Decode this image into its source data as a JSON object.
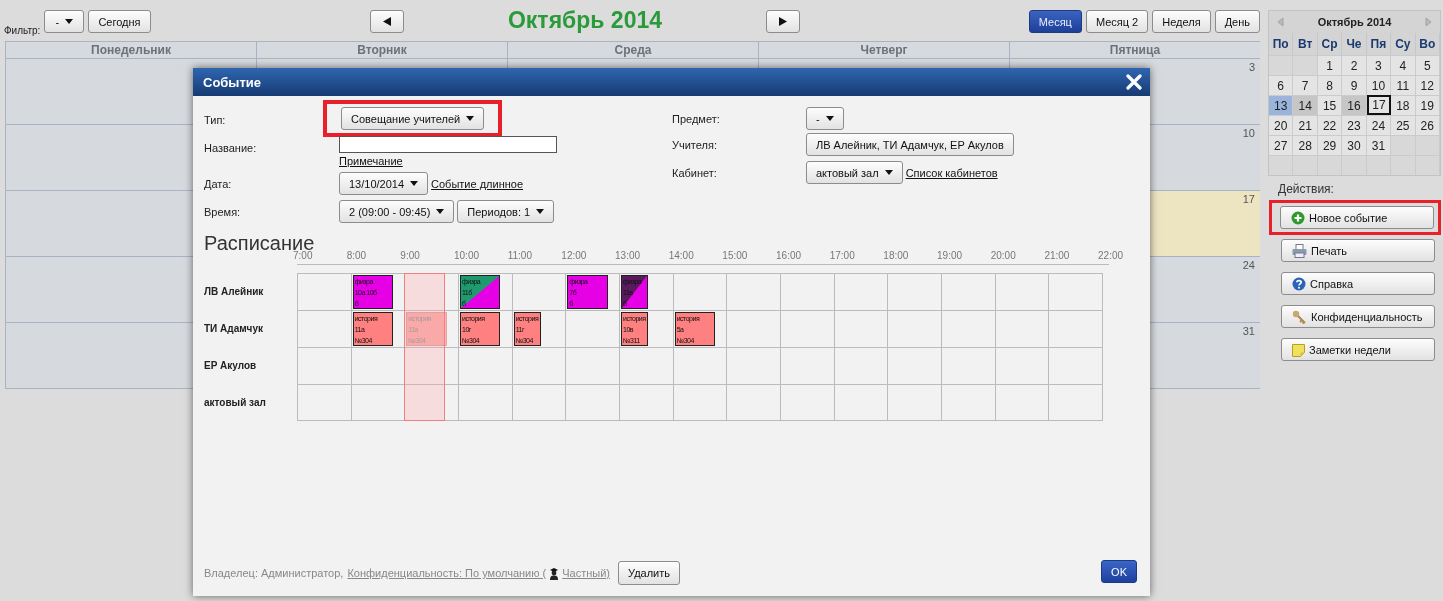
{
  "toolbar": {
    "filter_label": "Фильтр:",
    "filter_value": "-",
    "today_button": "Сегодня",
    "title": "Октябрь 2014",
    "views": [
      {
        "label": "Месяц",
        "selected": true
      },
      {
        "label": "Месяц 2",
        "selected": false
      },
      {
        "label": "Неделя",
        "selected": false
      },
      {
        "label": "День",
        "selected": false
      }
    ]
  },
  "calendar": {
    "weekdays": [
      "Понедельник",
      "Вторник",
      "Среда",
      "Четверг",
      "Пятница"
    ],
    "weeks": [
      {
        "monday": {
          "today": false
        },
        "friday": {
          "number": "3",
          "today": false
        }
      },
      {
        "monday": {
          "today": false
        },
        "friday": {
          "number": "10",
          "today": false
        }
      },
      {
        "monday": {
          "today": false
        },
        "friday": {
          "number": "17",
          "today": true
        }
      },
      {
        "monday": {
          "today": false
        },
        "friday": {
          "number": "24",
          "today": false
        }
      },
      {
        "monday": {
          "today": false
        },
        "friday": {
          "number": "31",
          "today": false
        }
      }
    ]
  },
  "dialog": {
    "title": "Событие",
    "fields_left": [
      {
        "label": "Тип:",
        "highlighted": true,
        "controls": [
          {
            "kind": "dropdown",
            "value": "Совещание учителей"
          }
        ]
      },
      {
        "label": "Название:",
        "highlighted": false,
        "controls": [
          {
            "kind": "input"
          },
          {
            "kind": "note_link",
            "text": "Примечание"
          }
        ]
      },
      {
        "label": "Дата:",
        "highlighted": false,
        "controls": [
          {
            "kind": "dropdown",
            "value": "13/10/2014"
          },
          {
            "kind": "link",
            "text": "Событие длинное"
          }
        ]
      },
      {
        "label": "Время:",
        "highlighted": false,
        "controls": [
          {
            "kind": "dropdown",
            "value": "2 (09:00 - 09:45)"
          },
          {
            "kind": "dropdown",
            "value": "Периодов: 1"
          }
        ]
      }
    ],
    "fields_right": [
      {
        "label": "Предмет:",
        "highlighted": false,
        "controls": [
          {
            "kind": "dropdown",
            "value": "-"
          }
        ]
      },
      {
        "label": "Учителя:",
        "highlighted": false,
        "controls": [
          {
            "kind": "button",
            "value": "ЛВ Алейник, ТИ Адамчук, ЕР Акулов"
          }
        ]
      },
      {
        "label": "Кабинет:",
        "highlighted": false,
        "controls": [
          {
            "kind": "dropdown",
            "value": "актовый зал"
          },
          {
            "kind": "link",
            "text": "Список кабинетов"
          }
        ]
      }
    ],
    "schedule": {
      "title": "Расписание",
      "hours": [
        {
          "label": "7:00",
          "selected": false
        },
        {
          "label": "8:00",
          "selected": false
        },
        {
          "label": "9:00",
          "selected": true
        },
        {
          "label": "10:00",
          "selected": false
        },
        {
          "label": "11:00",
          "selected": false
        },
        {
          "label": "12:00",
          "selected": false
        },
        {
          "label": "13:00",
          "selected": false
        },
        {
          "label": "14:00",
          "selected": false
        },
        {
          "label": "15:00",
          "selected": false
        },
        {
          "label": "16:00",
          "selected": false
        },
        {
          "label": "17:00",
          "selected": false
        },
        {
          "label": "18:00",
          "selected": false
        },
        {
          "label": "19:00",
          "selected": false
        },
        {
          "label": "20:00",
          "selected": false
        },
        {
          "label": "21:00",
          "selected": false
        },
        {
          "label": "22:00",
          "selected": false
        }
      ],
      "rows": [
        {
          "label": "ЛВ Алейник",
          "slots": [
            {
              "kind": "empty"
            },
            {
              "kind": "lesson",
              "ghost": false,
              "color": "#e600e6",
              "lines": [
                "физра",
                "10а 10б",
                "б"
              ]
            },
            {
              "kind": "empty"
            },
            {
              "kind": "lesson",
              "ghost": false,
              "color": "#e600e6",
              "corner": {
                "color": "#1e9a6e"
              },
              "lines": [
                "физра",
                "11б",
                "б"
              ]
            },
            {
              "kind": "empty"
            },
            {
              "kind": "lesson",
              "ghost": false,
              "color": "#e600e6",
              "lines": [
                "физра",
                "7б",
                "б"
              ]
            },
            {
              "kind": "short",
              "ghost": false,
              "color": "#e600e6",
              "corner": {
                "color": "#5a1a5e"
              },
              "lines": [
                "физра",
                "11в",
                "б"
              ]
            }
          ]
        },
        {
          "label": "ТИ Адамчук",
          "slots": [
            {
              "kind": "empty"
            },
            {
              "kind": "lesson",
              "ghost": false,
              "color": "#ff8080",
              "lines": [
                "история",
                "11а",
                "№304"
              ]
            },
            {
              "kind": "lesson",
              "ghost": true,
              "color": "#ff8080",
              "lines": [
                "история",
                "11а",
                "№304"
              ]
            },
            {
              "kind": "lesson",
              "ghost": false,
              "color": "#ff8080",
              "lines": [
                "история",
                "10г",
                "№304"
              ]
            },
            {
              "kind": "short",
              "ghost": false,
              "color": "#ff8080",
              "lines": [
                "история",
                "11г",
                "№304"
              ]
            },
            {
              "kind": "empty"
            },
            {
              "kind": "short",
              "ghost": false,
              "color": "#ff8080",
              "lines": [
                "история",
                "10в",
                "№311"
              ]
            },
            {
              "kind": "lesson",
              "ghost": false,
              "color": "#ff8080",
              "lines": [
                "история",
                "5а",
                "№304"
              ]
            }
          ]
        },
        {
          "label": "ЕР Акулов"
        },
        {
          "label": "актовый зал"
        }
      ]
    },
    "footer": {
      "owner": "Владелец: Администратор,",
      "privacy_link": "Конфиденциальность: По умолчанию (",
      "privacy_value": "Частный)",
      "delete_button": "Удалить",
      "ok_button": "OK"
    }
  },
  "sidebar": {
    "mini_calendar": {
      "title": "Октябрь 2014",
      "weekdays": [
        "По",
        "Вт",
        "Ср",
        "Че",
        "Пя",
        "Су",
        "Во"
      ],
      "weeks": [
        {
          "kind": "first",
          "days": [
            {
              "day": "1",
              "selected": false,
              "today": false,
              "marked": false
            },
            {
              "day": "2",
              "selected": false,
              "today": false,
              "marked": false
            },
            {
              "day": "3",
              "selected": false,
              "today": false,
              "marked": false
            },
            {
              "day": "4",
              "selected": false,
              "today": false,
              "marked": false
            },
            {
              "day": "5",
              "selected": false,
              "today": false,
              "marked": false
            }
          ]
        },
        {
          "kind": "regular",
          "days": [
            {
              "day": "6",
              "selected": false,
              "today": false,
              "marked": false
            },
            {
              "day": "7",
              "selected": false,
              "today": false,
              "marked": false
            },
            {
              "day": "8",
              "selected": false,
              "today": false,
              "marked": false
            },
            {
              "day": "9",
              "selected": false,
              "today": false,
              "marked": false
            },
            {
              "day": "10",
              "selected": false,
              "today": false,
              "marked": false
            },
            {
              "day": "11",
              "selected": false,
              "today": false,
              "marked": false
            },
            {
              "day": "12",
              "selected": false,
              "today": false,
              "marked": false
            }
          ]
        },
        {
          "kind": "regular",
          "days": [
            {
              "day": "13",
              "selected": true,
              "today": false,
              "marked": false
            },
            {
              "day": "14",
              "selected": false,
              "today": false,
              "marked": true
            },
            {
              "day": "15",
              "selected": false,
              "today": false,
              "marked": false
            },
            {
              "day": "16",
              "selected": false,
              "today": false,
              "marked": true
            },
            {
              "day": "17",
              "selected": false,
              "today": true,
              "marked": false
            },
            {
              "day": "18",
              "selected": false,
              "today": false,
              "marked": false
            },
            {
              "day": "19",
              "selected": false,
              "today": false,
              "marked": false
            }
          ]
        },
        {
          "kind": "regular",
          "days": [
            {
              "day": "20",
              "selected": false,
              "today": false,
              "marked": false
            },
            {
              "day": "21",
              "selected": false,
              "today": false,
              "marked": false
            },
            {
              "day": "22",
              "selected": false,
              "today": false,
              "marked": false
            },
            {
              "day": "23",
              "selected": false,
              "today": false,
              "marked": false
            },
            {
              "day": "24",
              "selected": false,
              "today": false,
              "marked": false
            },
            {
              "day": "25",
              "selected": false,
              "today": false,
              "marked": false
            },
            {
              "day": "26",
              "selected": false,
              "today": false,
              "marked": false
            }
          ]
        },
        {
          "kind": "regular",
          "days": [
            {
              "day": "27",
              "selected": false,
              "today": false,
              "marked": false
            },
            {
              "day": "28",
              "selected": false,
              "today": false,
              "marked": false
            },
            {
              "day": "29",
              "selected": false,
              "today": false,
              "marked": false
            },
            {
              "day": "30",
              "selected": false,
              "today": false,
              "marked": false
            },
            {
              "day": "31",
              "selected": false,
              "today": false,
              "marked": false
            }
          ]
        }
      ]
    },
    "actions": {
      "label": "Действия:",
      "buttons": [
        {
          "kind": "new",
          "label": "Новое событие",
          "highlighted": true
        },
        {
          "kind": "print",
          "label": "Печать",
          "highlighted": false
        },
        {
          "kind": "help",
          "label": "Справка",
          "highlighted": false
        },
        {
          "kind": "privacy",
          "label": "Конфиденциальность",
          "highlighted": false
        },
        {
          "kind": "notes",
          "label": "Заметки недели",
          "highlighted": false
        }
      ]
    }
  }
}
